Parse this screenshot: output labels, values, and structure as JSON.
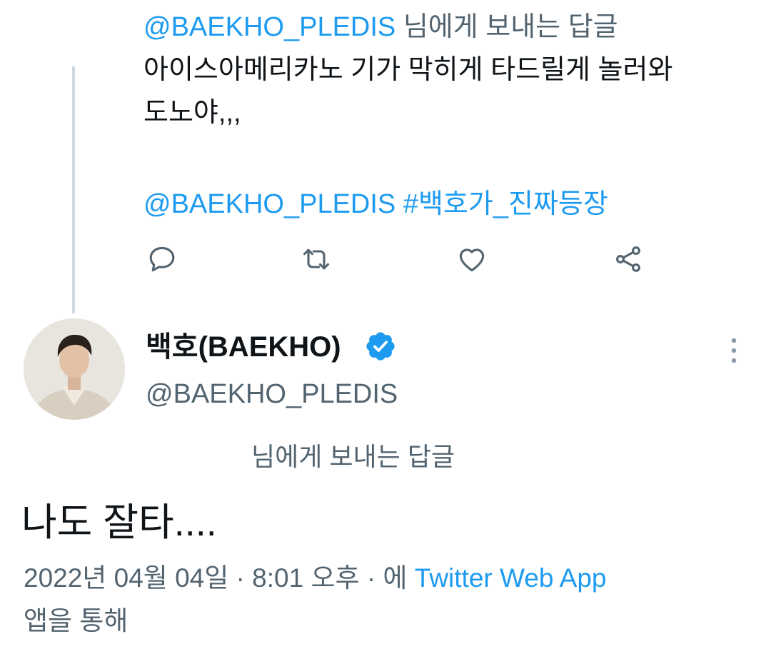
{
  "parent_tweet": {
    "reply_prefix_handle": "@BAEKHO_PLEDIS",
    "reply_prefix_text": " 님에게 보내는 답글",
    "text_line_1": "아이스아메리카노 기가 막히게 타드릴게 놀러와",
    "text_line_2": "도노야,,,",
    "mention": "@BAEKHO_PLEDIS",
    "hashtag": "#백호가_진짜등장"
  },
  "action_icons": [
    "reply-icon",
    "retweet-icon",
    "like-icon",
    "share-icon"
  ],
  "reply_tweet": {
    "display_name": "백호(BAEKHO)",
    "handle": "@BAEKHO_PLEDIS",
    "replying_to_text": "님에게 보내는 답글",
    "text": "나도 잘타....",
    "timestamp": "2022년 04월 04일 · 8:01 오후 · 에",
    "source_app": "Twitter Web App",
    "source_suffix": "앱을 통해"
  },
  "colors": {
    "link": "#1d9bf0",
    "muted": "#536471",
    "text": "#0f1419",
    "thread_line": "#cfd9de",
    "verified": "#1d9bf0"
  }
}
